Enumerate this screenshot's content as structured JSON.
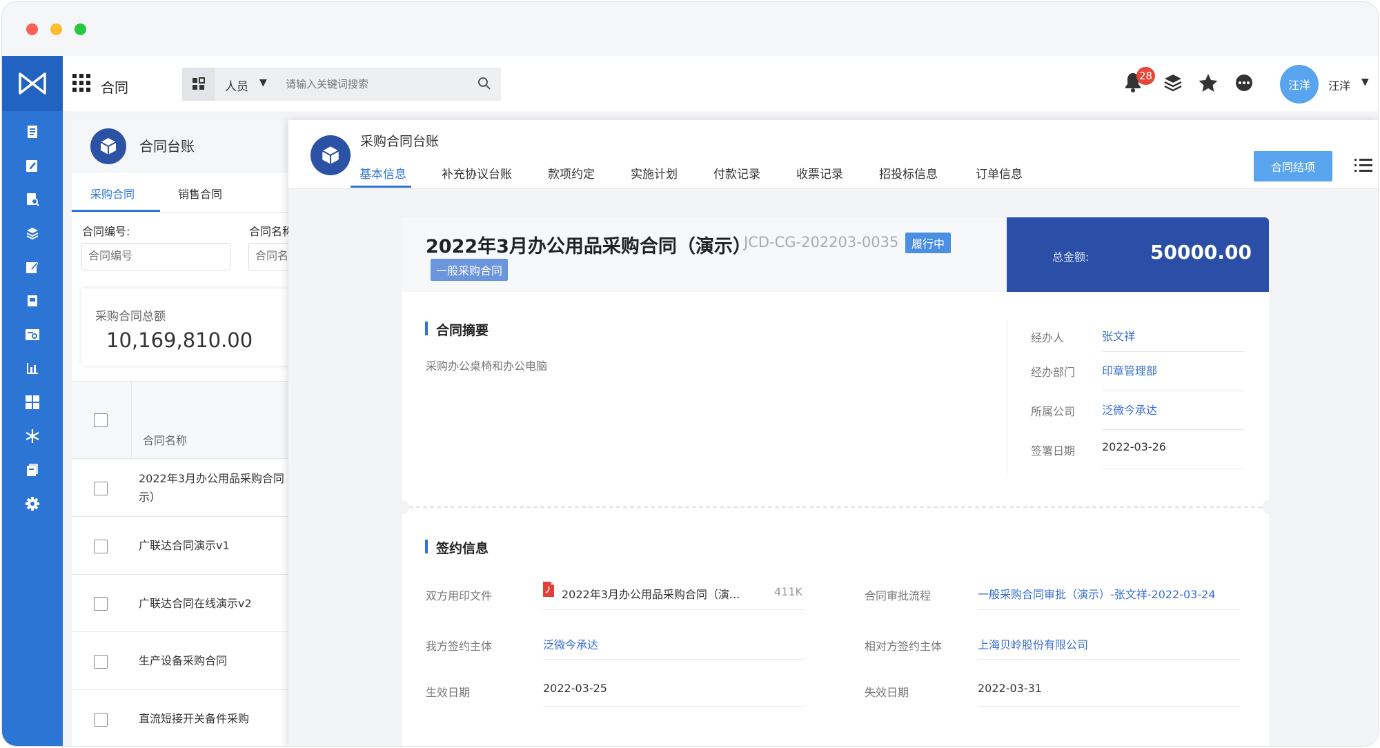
{
  "colors": {
    "accent": "#2d75d5",
    "sidebar": "#2d75d5",
    "total_bg": "#2b4fa6",
    "link": "#3a6fd1",
    "badge": "#e5473b"
  },
  "app": {
    "title": "合同"
  },
  "search": {
    "scope": "人员",
    "placeholder": "请输入关键词搜索"
  },
  "notifications": {
    "count": "28"
  },
  "user": {
    "avatar_text": "汪洋",
    "name": "汪洋"
  },
  "sidebar": {
    "icons": [
      "document-icon",
      "edit-icon",
      "doc-search-icon",
      "layers-icon",
      "form-edit-icon",
      "file-icon",
      "card-search-icon",
      "bar-chart-icon",
      "grid-icon",
      "snowflake-icon",
      "copy-icon",
      "gear-icon"
    ]
  },
  "list_panel": {
    "title": "合同台账",
    "tabs": [
      "采购合同",
      "销售合同"
    ],
    "filters": [
      {
        "label": "合同编号:",
        "placeholder": "合同编号"
      },
      {
        "label": "合同名称",
        "placeholder": "合同名"
      }
    ],
    "summary": {
      "label": "采购合同总额",
      "value": "10,169,810.00"
    },
    "table": {
      "header": "合同名称",
      "rows": [
        {
          "line1": "2022年3月办公用品采购合同（演",
          "line2": "示）"
        },
        {
          "line1": "广联达合同演示v1"
        },
        {
          "line1": "广联达合同在线演示v2"
        },
        {
          "line1": "生产设备采购合同"
        },
        {
          "line1": "直流短接开关备件采购"
        }
      ]
    }
  },
  "detail": {
    "title": "采购合同台账",
    "tabs": [
      "基本信息",
      "补充协议台账",
      "款项约定",
      "实施计划",
      "付款记录",
      "收票记录",
      "招投标信息",
      "订单信息"
    ],
    "close_button": "合同结项",
    "contract": {
      "name": "2022年3月办公用品采购合同（演示）",
      "code": "JCD-CG-202203-0035",
      "status": "履行中",
      "type": "一般采购合同",
      "total_label": "总金额:",
      "total_value": "50000.00"
    },
    "summary_section": {
      "title": "合同摘要",
      "text": "采购办公桌椅和办公电脑"
    },
    "side_info": [
      {
        "label": "经办人",
        "value": "张文祥"
      },
      {
        "label": "经办部门",
        "value": "印章管理部"
      },
      {
        "label": "所属公司",
        "value": "泛微今承达"
      },
      {
        "label": "签署日期",
        "value": "2022-03-26"
      }
    ],
    "sign_section": {
      "title": "签约信息",
      "file_label": "双方用印文件",
      "file_name": "2022年3月办公用品采购合同（演...",
      "file_size": "411K",
      "approval_label": "合同审批流程",
      "approval_value": "一般采购合同审批（演示）-张文祥-2022-03-24",
      "our_party_label": "我方签约主体",
      "our_party_value": "泛微今承达",
      "counter_party_label": "相对方签约主体",
      "counter_party_value": "上海贝岭股份有限公司",
      "effective_label": "生效日期",
      "effective_value": "2022-03-25",
      "expire_label": "失效日期",
      "expire_value": "2022-03-31"
    }
  }
}
